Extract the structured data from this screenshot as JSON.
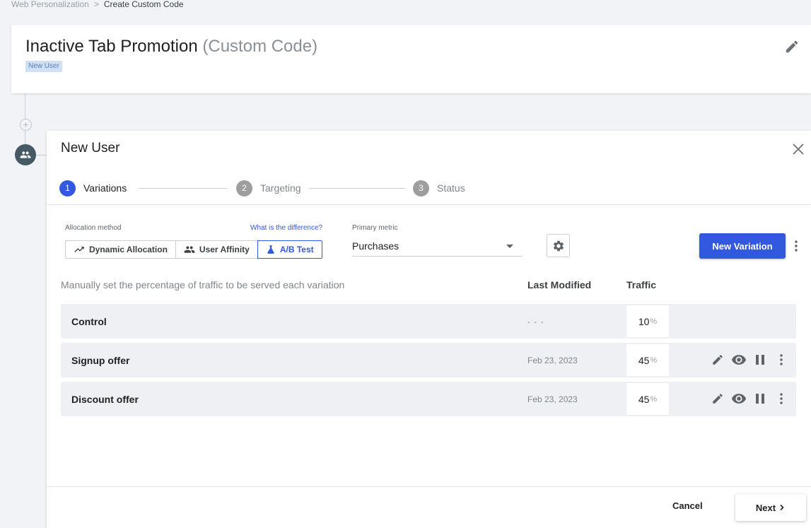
{
  "breadcrumb": {
    "parent": "Web Personalization",
    "separator": ">",
    "current": "Create Custom Code"
  },
  "campaign": {
    "title": "Inactive Tab Promotion",
    "subtype": "(Custom Code)",
    "segment_tag": "New User"
  },
  "panel": {
    "title": "New User",
    "steps": [
      {
        "number": "1",
        "label": "Variations",
        "active": true
      },
      {
        "number": "2",
        "label": "Targeting",
        "active": false
      },
      {
        "number": "3",
        "label": "Status",
        "active": false
      }
    ]
  },
  "allocation": {
    "label": "Allocation method",
    "help_link": "What is the difference?",
    "options": [
      {
        "label": "Dynamic Allocation",
        "icon": "trending-up-icon",
        "selected": false
      },
      {
        "label": "User Affinity",
        "icon": "users-icon",
        "selected": false
      },
      {
        "label": "A/B Test",
        "icon": "flask-icon",
        "selected": true
      }
    ]
  },
  "primary_metric": {
    "label": "Primary metric",
    "value": "Purchases"
  },
  "actions": {
    "new_variation": "New Variation"
  },
  "table": {
    "description": "Manually set the percentage of traffic to be served each variation",
    "columns": {
      "last_modified": "Last Modified",
      "traffic": "Traffic"
    },
    "rows": [
      {
        "name": "Control",
        "modified": "- - -",
        "traffic": "10",
        "unit": "%"
      },
      {
        "name": "Signup offer",
        "modified": "Feb 23, 2023",
        "traffic": "45",
        "unit": "%"
      },
      {
        "name": "Discount offer",
        "modified": "Feb 23, 2023",
        "traffic": "45",
        "unit": "%"
      }
    ]
  },
  "footer": {
    "cancel": "Cancel",
    "next": "Next",
    "next_icon": "chevron-right-icon"
  },
  "colors": {
    "accent": "#3358e0",
    "step_inactive": "#9e9e9e",
    "node": "#455a64",
    "tag_bg": "#cfe0f5"
  }
}
